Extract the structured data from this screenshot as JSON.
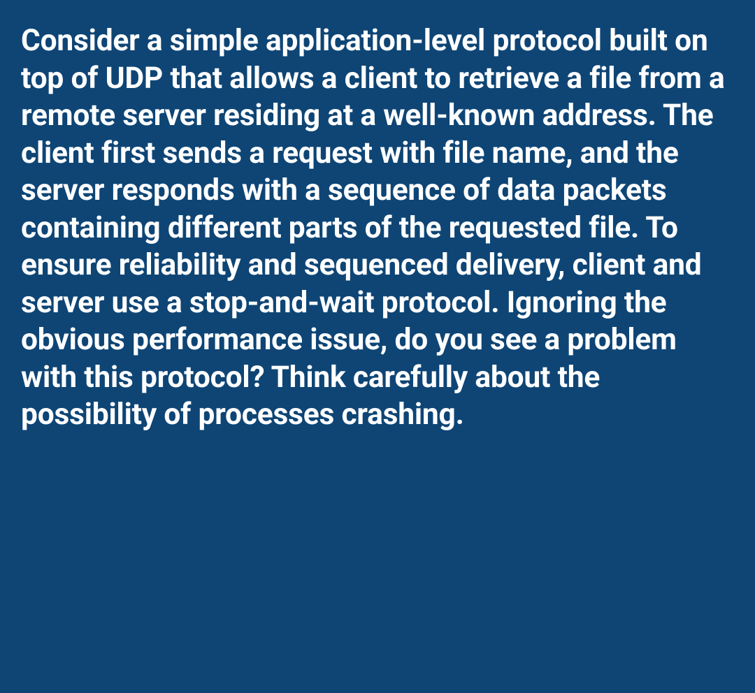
{
  "question": {
    "text": "Consider a simple application-level protocol built on top of UDP that allows a client to retrieve a file from a remote server residing at a well-known address. The client first sends a request with file name, and the server responds with a sequence of data packets containing different parts of the requested file. To ensure reliability and sequenced delivery, client and server use a stop-and-wait protocol. Ignoring the obvious performance issue, do you see a problem with this protocol? Think carefully about the possibility of processes crashing."
  },
  "colors": {
    "background": "#0e4575",
    "text": "#ffffff"
  }
}
